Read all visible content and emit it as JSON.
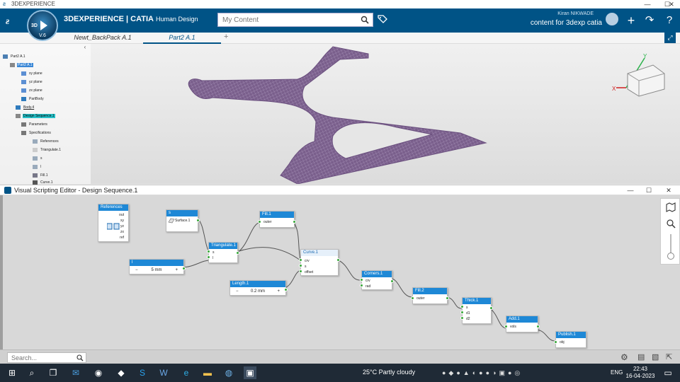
{
  "window": {
    "title": "3DEXPERIENCE"
  },
  "app": {
    "brand_prefix": "3DEXPERIENCE | CATIA",
    "brand_suffix": "Human Design",
    "compass_label": "3D",
    "compass_version": "V.6",
    "search_placeholder": "My Content",
    "user_name": "Kiran NIKWADE",
    "user_context": "content for 3dexp catia"
  },
  "tabs": [
    {
      "label": "Newt_BackPack A.1"
    },
    {
      "label": "Part2 A.1"
    }
  ],
  "tree": [
    {
      "label": "Part2 A.1"
    },
    {
      "label": "Part2 A.1"
    },
    {
      "label": "xy plane"
    },
    {
      "label": "yz plane"
    },
    {
      "label": "zx plane"
    },
    {
      "label": "PartBody"
    },
    {
      "label": "Body.4"
    },
    {
      "label": "Design Sequence.1"
    },
    {
      "label": "Parameters"
    },
    {
      "label": "Specifications"
    },
    {
      "label": "References"
    },
    {
      "label": "Triangulate.1"
    },
    {
      "label": "s"
    },
    {
      "label": "l"
    },
    {
      "label": "Fill.1"
    },
    {
      "label": "Curve.1"
    }
  ],
  "vse": {
    "title": "Visual Scripting Editor - Design Sequence.1",
    "search_placeholder": "Search...",
    "nodes": {
      "references": {
        "title": "References",
        "ports": [
          "out",
          "xy",
          "yz",
          "zx",
          "ref"
        ]
      },
      "s": {
        "title": "s",
        "value": "Surface.1"
      },
      "l": {
        "title": "l",
        "minus": "−",
        "value": "5 mm",
        "plus": "+"
      },
      "fill1": {
        "title": "Fill.1",
        "port": "outer"
      },
      "triangulate": {
        "title": "Triangulate.1",
        "ports": [
          "s",
          "l"
        ]
      },
      "curve": {
        "title": "Curve.1",
        "ports": [
          "crv",
          "s",
          "offset"
        ]
      },
      "length": {
        "title": "Length.1",
        "minus": "−",
        "value": "0.2 mm",
        "plus": "+"
      },
      "corners": {
        "title": "Corners.1",
        "ports": [
          "crv",
          "rad"
        ]
      },
      "fill2": {
        "title": "Fill.2",
        "port": "outer"
      },
      "thick": {
        "title": "Thick.1",
        "ports": [
          "s",
          "d1",
          "d2"
        ]
      },
      "add": {
        "title": "Add.1",
        "port": "vols"
      },
      "publish": {
        "title": "Publish.1",
        "port": "obj"
      }
    }
  },
  "taskbar": {
    "weather": "25°C  Partly cloudy",
    "lang": "ENG",
    "time": "22:43",
    "date": "16-04-2023"
  },
  "colors": {
    "brand_blue": "#005386",
    "node_header": "#1e88d6",
    "port_green": "#38a83a",
    "mesh_purple": "#7a5f8c"
  }
}
